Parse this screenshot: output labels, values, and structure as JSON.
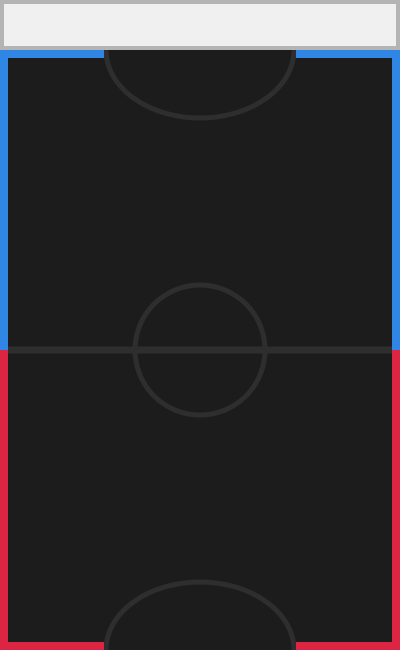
{
  "scoreboard": {
    "text": ""
  },
  "colors": {
    "field": "#1c1c1c",
    "field_lines": "#2e2e2e",
    "top_player": "#2f86e4",
    "bottom_player": "#dc2443",
    "panel_background": "#f0f0f0",
    "panel_border": "#b4b4b4"
  },
  "players": {
    "top": {
      "color_name": "blue"
    },
    "bottom": {
      "color_name": "red"
    }
  }
}
